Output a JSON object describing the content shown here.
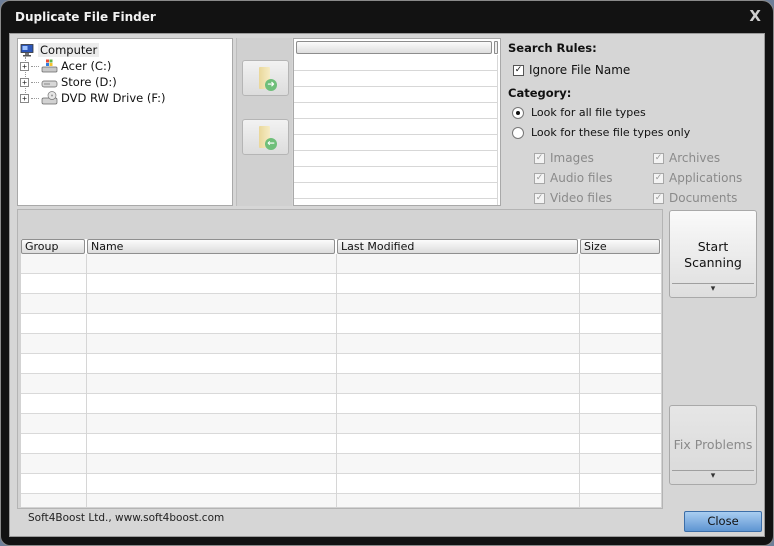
{
  "window": {
    "title": "Duplicate File Finder",
    "close_glyph": "X"
  },
  "tree": {
    "root": {
      "label": "Computer",
      "icon": "computer-icon"
    },
    "items": [
      {
        "label": "Acer (C:)",
        "icon": "windows-drive-icon",
        "expander": "+"
      },
      {
        "label": "Store (D:)",
        "icon": "hard-drive-icon",
        "expander": "+"
      },
      {
        "label": "DVD RW Drive (F:)",
        "icon": "dvd-drive-icon",
        "expander": "+"
      }
    ]
  },
  "folder_buttons": {
    "add": {
      "icon": "add-folder-icon",
      "glyph": "➜"
    },
    "remove": {
      "icon": "remove-folder-icon",
      "glyph": "←"
    }
  },
  "search_rules": {
    "heading": "Search Rules:",
    "ignore_file_name": {
      "label": "Ignore File Name",
      "checked": true
    },
    "category_heading": "Category:",
    "radio_all": {
      "label": "Look for all file types",
      "selected": true
    },
    "radio_only": {
      "label": "Look for these file types only",
      "selected": false
    },
    "types": [
      {
        "label": "Images",
        "checked": true,
        "enabled": false
      },
      {
        "label": "Archives",
        "checked": true,
        "enabled": false
      },
      {
        "label": "Audio files",
        "checked": true,
        "enabled": false
      },
      {
        "label": "Applications",
        "checked": true,
        "enabled": false
      },
      {
        "label": "Video files",
        "checked": true,
        "enabled": false
      },
      {
        "label": "Documents",
        "checked": true,
        "enabled": false
      }
    ],
    "check_glyph": "✓"
  },
  "results_table": {
    "columns": [
      "Group",
      "Name",
      "Last Modified",
      "Size"
    ],
    "rows": []
  },
  "buttons": {
    "start_scanning_line1": "Start",
    "start_scanning_line2": "Scanning",
    "fix_problems": "Fix Problems",
    "dropdown_glyph": "▾",
    "close": "Close"
  },
  "footer": {
    "text": "Soft4Boost Ltd., www.soft4boost.com"
  }
}
